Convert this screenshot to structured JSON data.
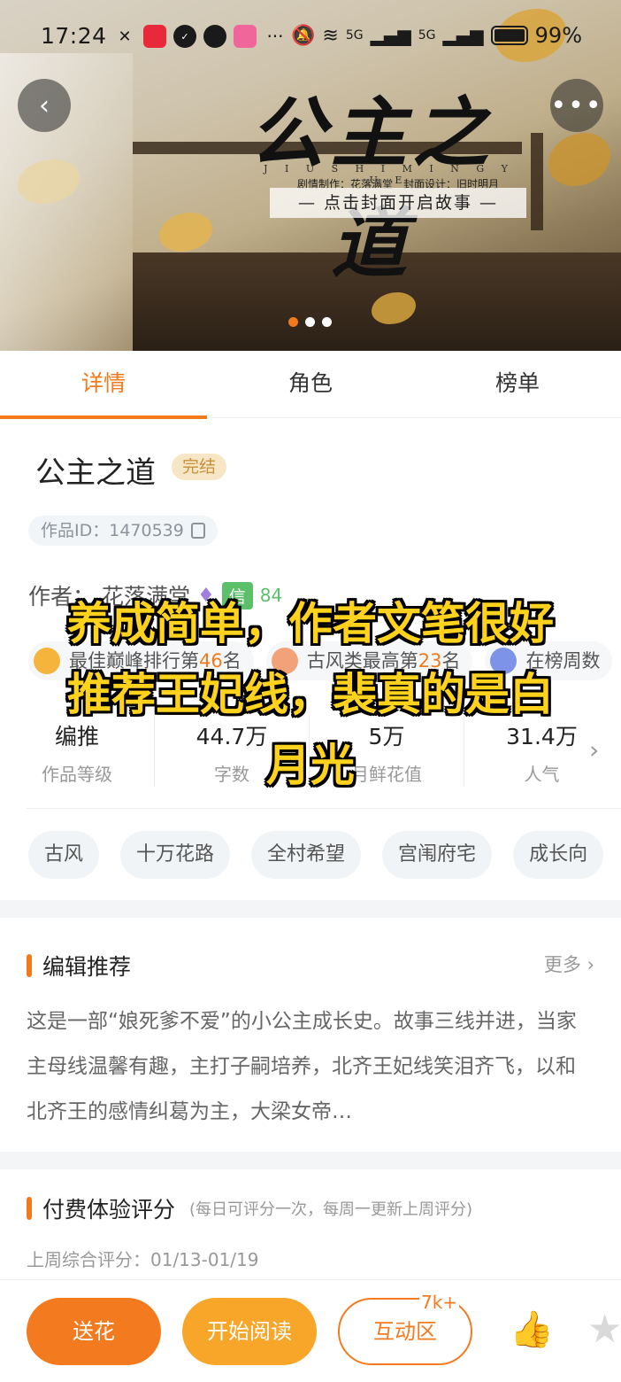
{
  "status_bar": {
    "time": "17:24",
    "network1": "5G",
    "network2": "5G",
    "battery": "99%"
  },
  "cover": {
    "title": "公主之道",
    "pinyin": "J I U S H I M I N G Y U E",
    "credit": "剧情制作：花落满堂　封面设计：旧时明月",
    "cta": "— 点击封面开启故事 —"
  },
  "tabs": [
    {
      "label": "详情"
    },
    {
      "label": "角色"
    },
    {
      "label": "榜单"
    }
  ],
  "detail": {
    "title": "公主之道",
    "status_badge": "完结",
    "work_id": "作品ID：1470539",
    "author_prefix": "作者：",
    "author_name": "花落满堂",
    "credit_label": "信",
    "credit_score": "84"
  },
  "rankings": [
    {
      "prefix": "最佳巅峰排行第",
      "num": "46",
      "suffix": "名",
      "color": "#f5b43c"
    },
    {
      "prefix": "古风类最高第",
      "num": "23",
      "suffix": "名",
      "color": "#f2a278"
    },
    {
      "prefix": "在榜周数",
      "num": "",
      "suffix": "",
      "color": "#7c93e8"
    }
  ],
  "stats": [
    {
      "value": "编推",
      "label": "作品等级"
    },
    {
      "value": "44.7万",
      "label": "字数"
    },
    {
      "value": "5万",
      "label": "月鲜花值"
    },
    {
      "value": "31.4万",
      "label": "人气"
    }
  ],
  "tags": [
    "古风",
    "十万花路",
    "全村希望",
    "宫闱府宅",
    "成长向"
  ],
  "editor_section": {
    "title": "编辑推荐",
    "more": "更多 ›",
    "text": "这是一部“娘死爹不爱”的小公主成长史。故事三线并进，当家主母线温馨有趣，主打子嗣培养，北齐王妃线笑泪齐飞，以和北齐王的感情纠葛为主，大梁女帝…"
  },
  "score_section": {
    "title": "付费体验评分",
    "subtitle": "(每日可评分一次，每周一更新上周评分)",
    "meta": "上周综合评分：01/13-01/19"
  },
  "bottom_bar": {
    "flower": "送花",
    "read": "开始阅读",
    "forum": "互动区",
    "forum_count": "7k+"
  },
  "overlay_caption": {
    "line1": "养成简单，作者文笔很好",
    "line2": "推荐王妃线，裴真的是白",
    "line3": "月光"
  },
  "colors": {
    "accent": "#f07a1c",
    "read_button": "#f7a62a",
    "credit_green": "#5cc06a",
    "caption": "#ffd21e"
  }
}
